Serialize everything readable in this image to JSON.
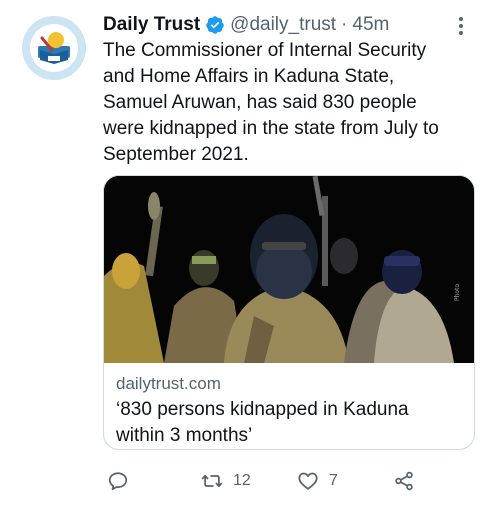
{
  "account": {
    "name": "Daily Trust",
    "handle": "@daily_trust",
    "separator": "·",
    "time": "45m"
  },
  "tweet": {
    "lines": [
      "The Commissioner of Internal Security",
      "and Home Affairs in Kaduna State,",
      "Samuel Aruwan, has said 830 people",
      "were kidnapped in the state from July to",
      "September 2021."
    ]
  },
  "card": {
    "domain": "dailytrust.com",
    "title_lines": [
      "‘830 persons kidnapped in Kaduna",
      "within 3 months’"
    ],
    "image_icon": "photo-of-armed-men"
  },
  "actions": {
    "reply_icon": "reply-icon",
    "retweet_icon": "retweet-icon",
    "retweet_count": "12",
    "like_icon": "heart-icon",
    "like_count": "7",
    "share_icon": "share-icon"
  },
  "colors": {
    "text": "#0f1419",
    "secondary": "#536471",
    "verified": "#1d9bf0",
    "border": "#cfd9de",
    "avatar_bg": "#cde4f3"
  }
}
